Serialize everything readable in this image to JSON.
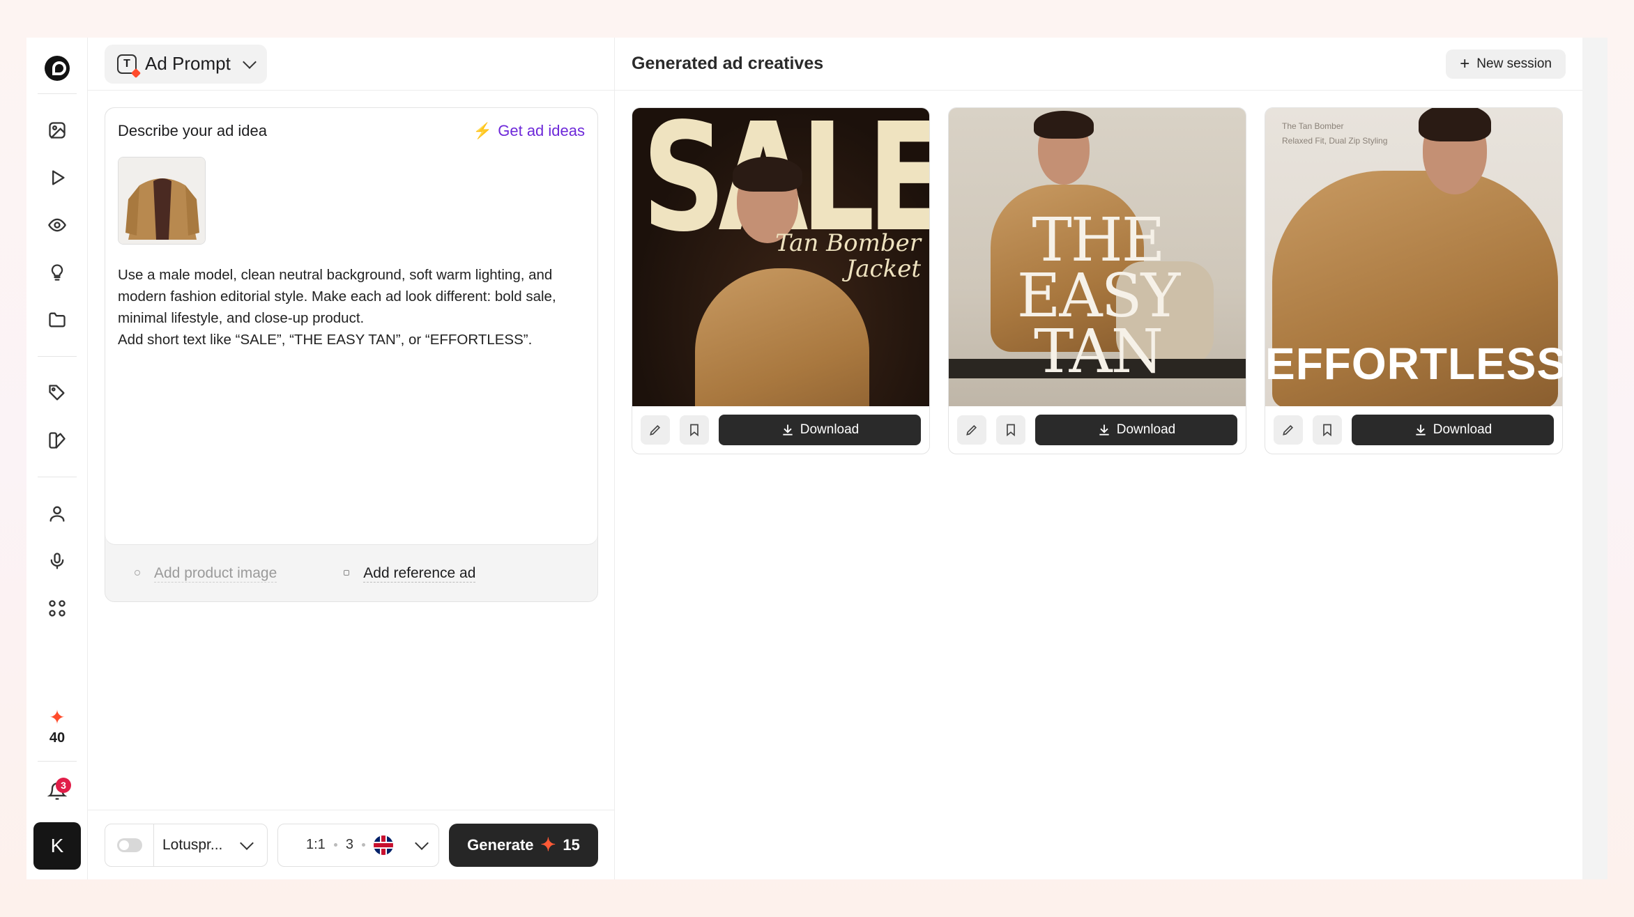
{
  "rail": {
    "credits": "40",
    "notifications": "3",
    "avatar_initial": "K"
  },
  "left": {
    "mode_label": "Ad Prompt",
    "card_title": "Describe your ad idea",
    "ideas_label": "Get ad ideas",
    "prompt_text": "Use a male model, clean neutral background, soft warm lighting, and modern fashion editorial style. Make each ad look different: bold sale, minimal lifestyle, and close-up product.\nAdd short text like “SALE”, “THE EASY TAN”, or “EFFORTLESS”.",
    "add_product_image": "Add product image",
    "add_reference_ad": "Add reference ad",
    "model_label": "Lotuspr...",
    "aspect": "1:1",
    "count": "3",
    "generate_label": "Generate",
    "generate_cost": "15"
  },
  "right": {
    "title": "Generated ad creatives",
    "new_session": "New session",
    "cards": [
      {
        "headline": "SALE",
        "subline": "Tan Bomber\nJacket",
        "download": "Download"
      },
      {
        "headline": "THE\nEASY\nTAN",
        "download": "Download"
      },
      {
        "headline": "EFFORTLESS",
        "small_text": "The Tan Bomber\nRelaxed Fit, Dual Zip Styling",
        "download": "Download"
      }
    ]
  },
  "colors": {
    "accent_purple": "#6d28d9",
    "credit_star": "#ff4b2b",
    "badge_red": "#e11d48",
    "dark_button": "#262626"
  }
}
